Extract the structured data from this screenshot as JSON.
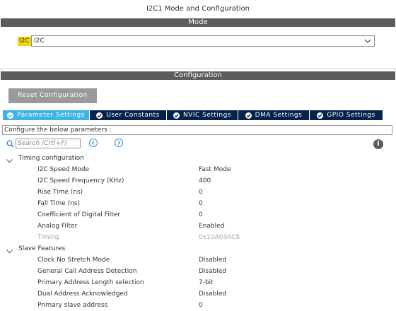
{
  "window": {
    "title": "I2C1 Mode and Configuration"
  },
  "mode_section": {
    "header": "Mode",
    "field_label": "I2C",
    "selected_value": "I2C"
  },
  "config_section": {
    "header": "Configuration",
    "reset_button": "Reset Configuration",
    "tabs": [
      {
        "label": "Parameter Settings",
        "active": true
      },
      {
        "label": "User Constants",
        "active": false
      },
      {
        "label": "NVIC Settings",
        "active": false
      },
      {
        "label": "DMA Settings",
        "active": false
      },
      {
        "label": "GPIO Settings",
        "active": false
      }
    ],
    "params_header": "Configure the below parameters :",
    "search": {
      "placeholder": "Search (Crtl+F)"
    },
    "info_label": "i",
    "groups": [
      {
        "label": "Timing configuration",
        "params": [
          {
            "name": "I2C Speed Mode",
            "value": "Fast Mode"
          },
          {
            "name": "I2C Speed Frequency (KHz)",
            "value": "400"
          },
          {
            "name": "Rise Time (ns)",
            "value": "0"
          },
          {
            "name": "Fall Time (ns)",
            "value": "0"
          },
          {
            "name": "Coefficient of Digital Filter",
            "value": "0"
          },
          {
            "name": "Analog Filter",
            "value": "Enabled"
          },
          {
            "name": "Timing",
            "value": "0x10A03AC5",
            "disabled": true
          }
        ]
      },
      {
        "label": "Slave Features",
        "params": [
          {
            "name": "Clock No Stretch Mode",
            "value": "Disabled"
          },
          {
            "name": "General Call Address Detection",
            "value": "Disabled"
          },
          {
            "name": "Primary Address Length selection",
            "value": "7-bit"
          },
          {
            "name": "Dual Address Acknowledged",
            "value": "Disabled"
          },
          {
            "name": "Primary slave address",
            "value": "0"
          }
        ]
      }
    ]
  },
  "colors": {
    "section_bar": "#5d5d5d",
    "tab_active": "#3cb4e6",
    "tab_inactive": "#03234b",
    "mode_highlight": "#f6d80a",
    "reset_button": "#9a9a9a"
  }
}
